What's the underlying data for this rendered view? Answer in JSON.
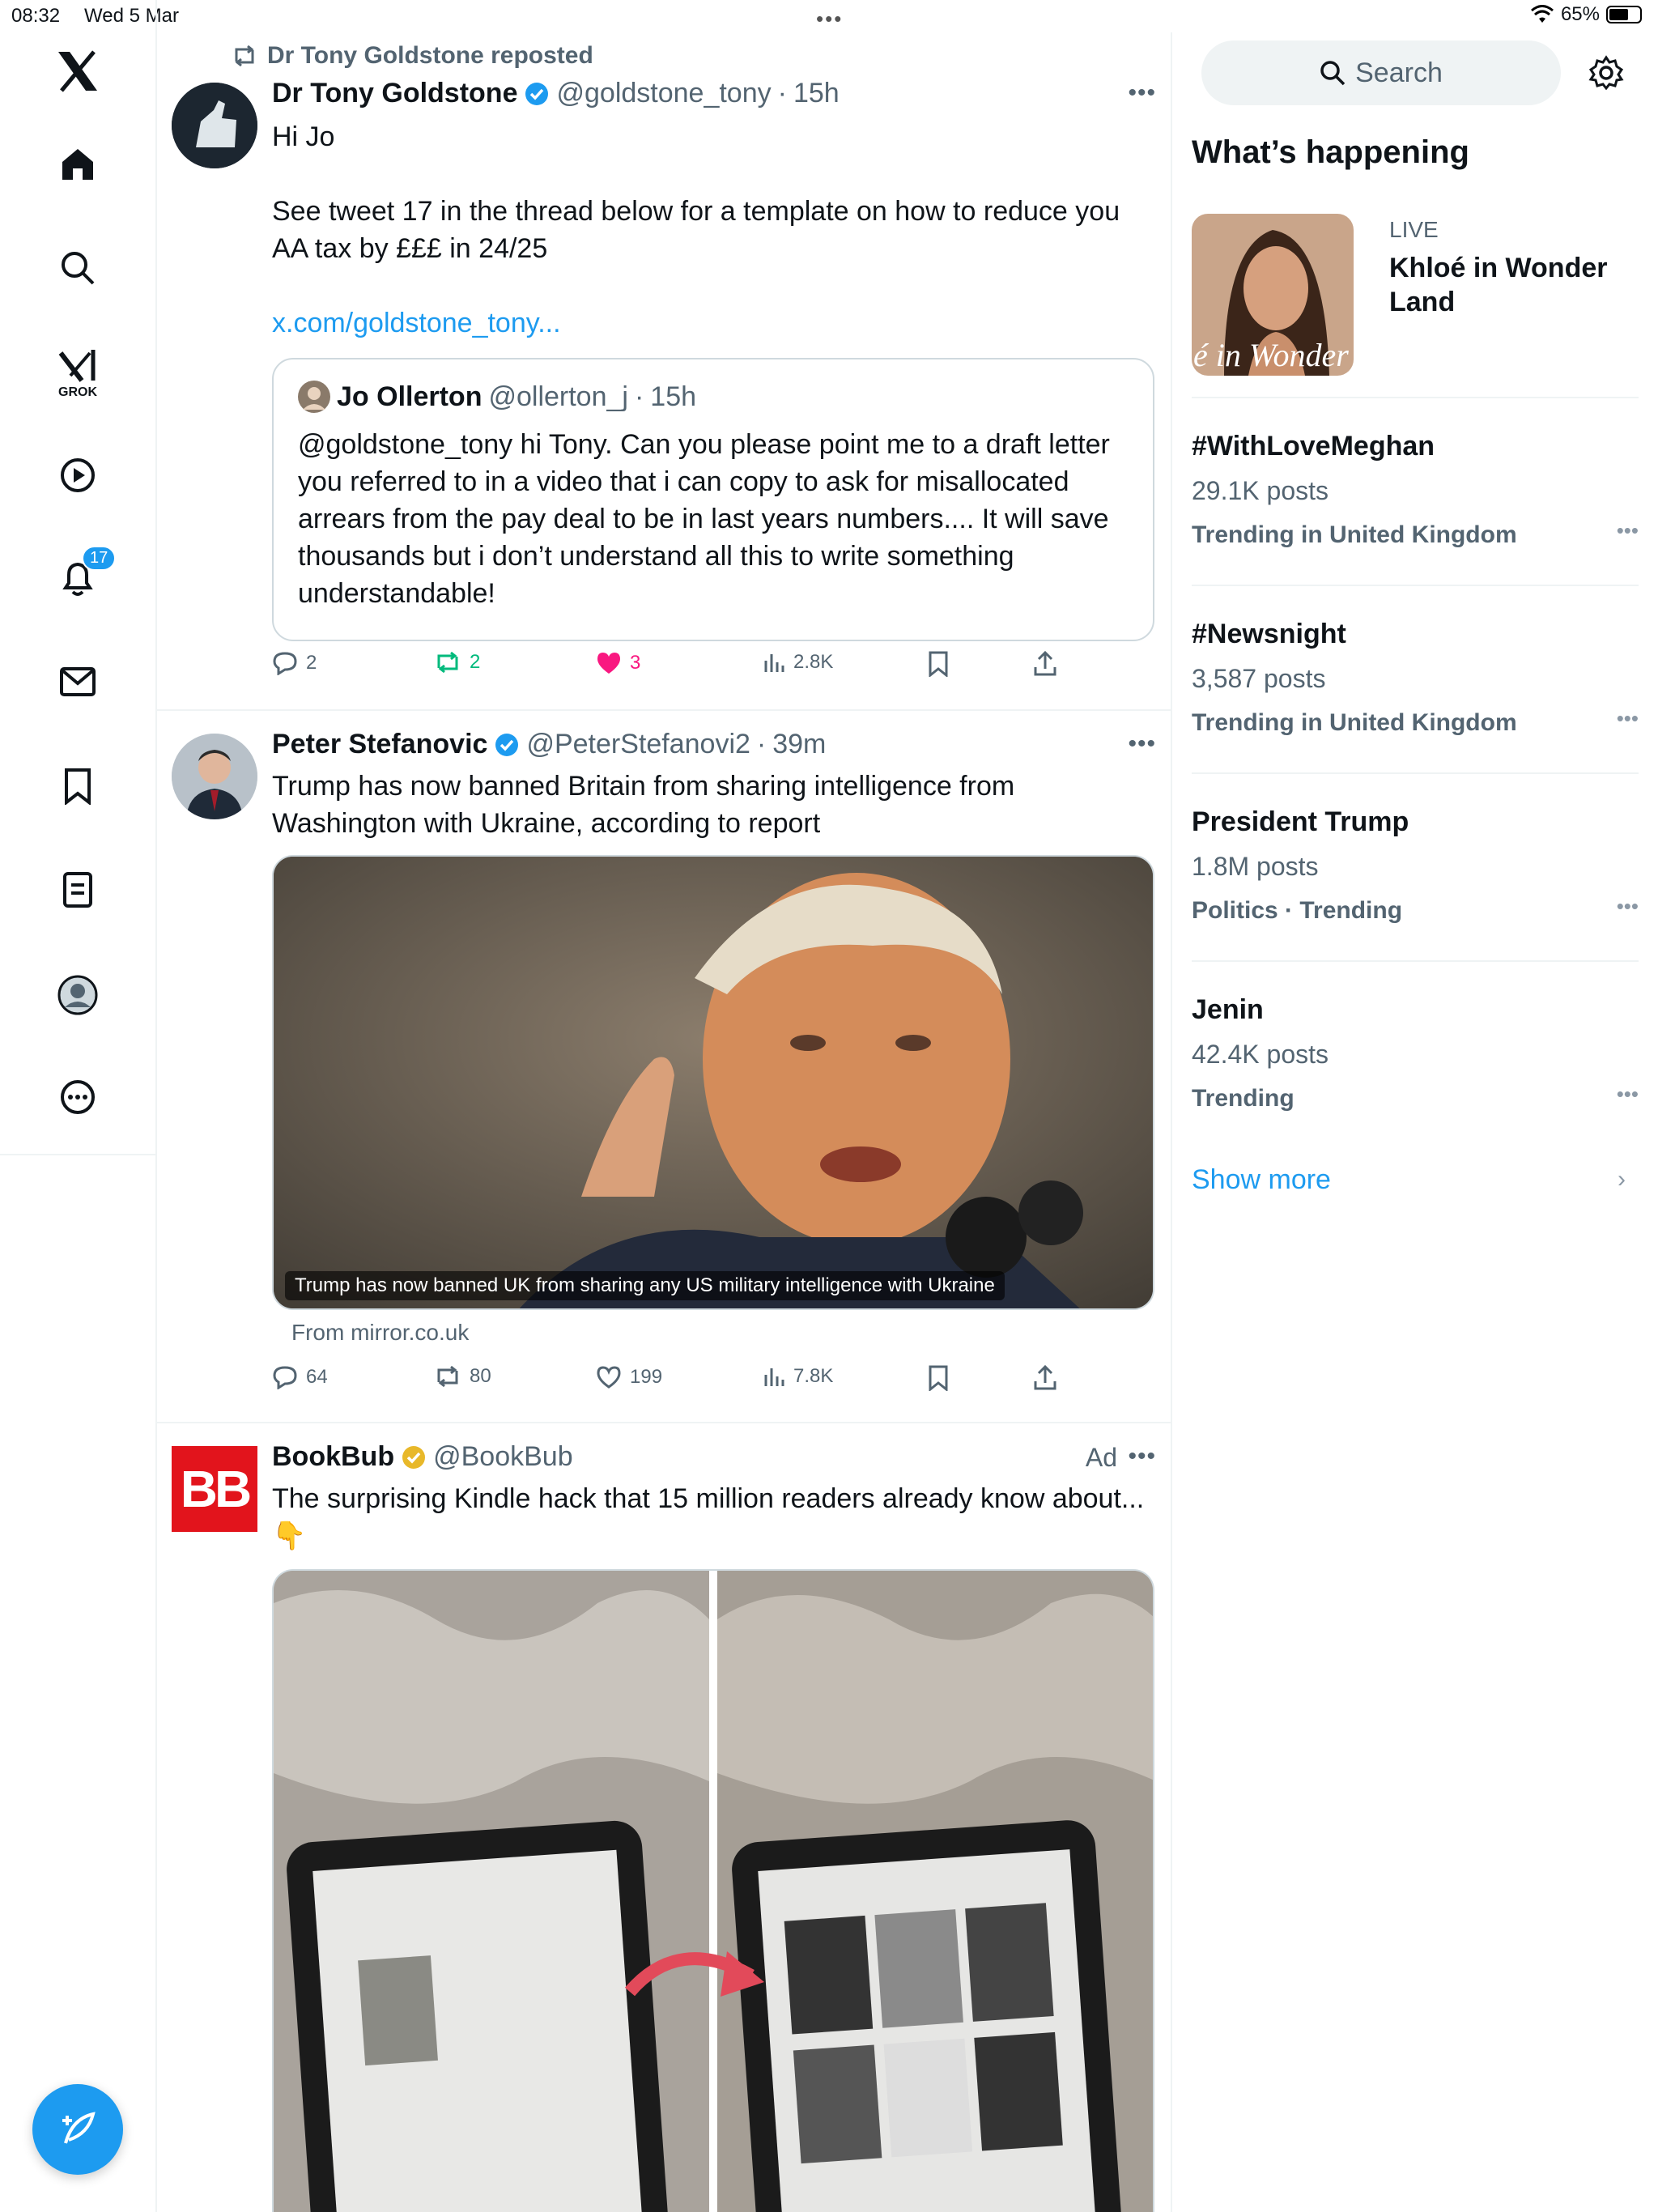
{
  "status": {
    "time": "08:32",
    "date": "Wed 5 Mar",
    "battery": "65%",
    "battery_level": 0.65
  },
  "nav": {
    "grok_label": "GROK",
    "notification_count": "17"
  },
  "posts": [
    {
      "repost_by": "Dr Tony Goldstone reposted",
      "name": "Dr Tony Goldstone",
      "handle": "@goldstone_tony",
      "time": "15h",
      "line1": "Hi Jo",
      "line2": "See tweet 17 in  the thread below for a template on how to reduce you AA tax by £££ in 24/25",
      "link": "x.com/goldstone_tony...",
      "quote": {
        "name": "Jo Ollerton",
        "handle": "@ollerton_j",
        "time": "15h",
        "text": "@goldstone_tony hi Tony. Can you please point me to a draft letter you referred to in a video that i can copy to ask for misallocated arrears from the pay deal to be in last years numbers.... It will save thousands but i don’t understand all this to write something understandable!"
      },
      "replies": "2",
      "reposts": "2",
      "likes": "3",
      "views": "2.8K"
    },
    {
      "name": "Peter Stefanovic",
      "handle": "@PeterStefanovi2",
      "time": "39m",
      "text": "Trump has now banned Britain from sharing intelligence from Washington with Ukraine, according to report",
      "media_caption": "Trump has now banned UK from sharing any US military intelligence with Ukraine",
      "from": "From mirror.co.uk",
      "replies": "64",
      "reposts": "80",
      "likes": "199",
      "views": "7.8K"
    },
    {
      "name": "BookBub",
      "handle": "@BookBub",
      "ad": "Ad",
      "text": "The surprising Kindle hack that 15 million readers already know about...",
      "emoji": "👇",
      "logo": "BB"
    }
  ],
  "sidebar": {
    "search_placeholder": "Search",
    "title": "What’s happening",
    "live": {
      "tag": "LIVE",
      "title": "Khloé in Wonder Land",
      "image_text": "é in Wonder l"
    },
    "trends": [
      {
        "name": "#WithLoveMeghan",
        "count": "29.1K posts",
        "context": "Trending in United Kingdom"
      },
      {
        "name": "#Newsnight",
        "count": "3,587 posts",
        "context": "Trending in United Kingdom"
      },
      {
        "name": "President Trump",
        "count": "1.8M posts",
        "context": "Politics · Trending"
      },
      {
        "name": "Jenin",
        "count": "42.4K posts",
        "context": "Trending"
      }
    ],
    "show_more": "Show more"
  },
  "colors": {
    "accent": "#1d9bf0",
    "like": "#f91880",
    "repost": "#00ba7c",
    "bookbub": "#e2141c"
  }
}
